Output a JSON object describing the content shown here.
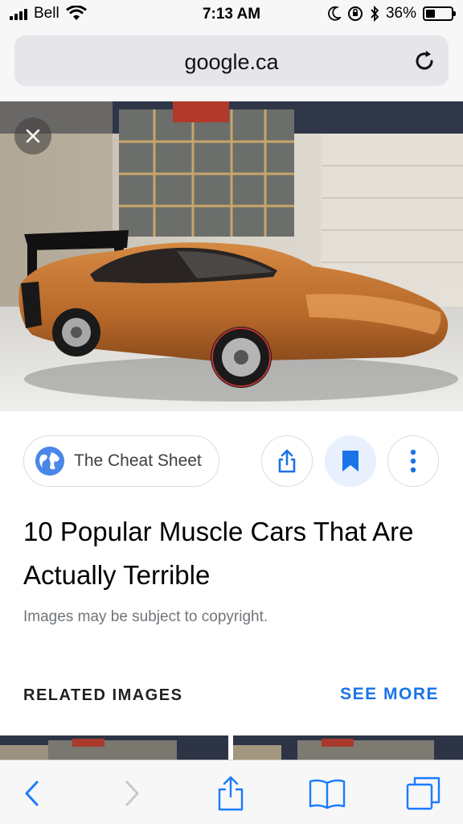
{
  "status_bar": {
    "carrier": "Bell",
    "time": "7:13 AM",
    "battery": "36%",
    "battery_level": 0.36
  },
  "url_bar": {
    "url": "google.ca"
  },
  "image": {
    "description_icon": "car-photo"
  },
  "source": {
    "name": "The Cheat Sheet",
    "icon": "globe-icon"
  },
  "actions": [
    "share-icon",
    "bookmark-icon",
    "more-vert-icon"
  ],
  "result": {
    "title": "10 Popular Muscle Cars That Are Actually Terrible",
    "copyright": "Images may be subject to copyright."
  },
  "related": {
    "heading": "RELATED IMAGES",
    "see_more": "SEE MORE"
  },
  "colors": {
    "accent": "#1a73e8",
    "car": "#c4762f"
  }
}
